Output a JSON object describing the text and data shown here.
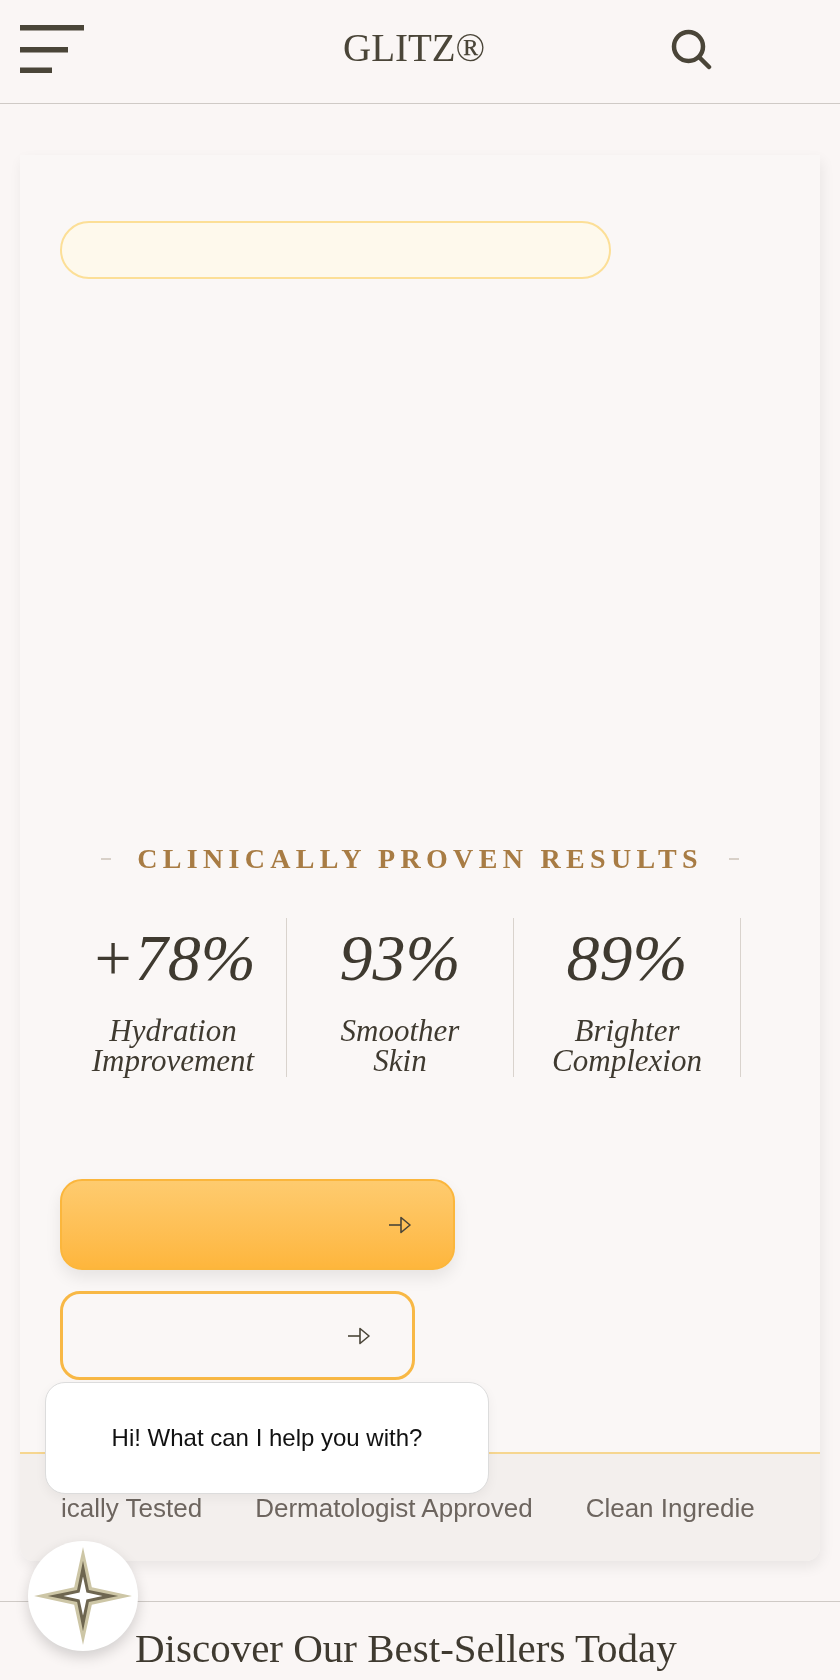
{
  "header": {
    "logo": "GLITZ®"
  },
  "results": {
    "title": "CLINICALLY PROVEN RESULTS",
    "stats": [
      {
        "value": "+78%",
        "label": "Hydration Improvement"
      },
      {
        "value": "93%",
        "label": "Smoother Skin"
      },
      {
        "value": "89%",
        "label": "Brighter Complexion"
      }
    ]
  },
  "buttons": [
    {
      "kind": "filled"
    },
    {
      "kind": "outline"
    }
  ],
  "trust_strip": [
    "ically Tested",
    "Dermatologist Approved",
    "Clean Ingredie"
  ],
  "chat": {
    "greeting": "Hi! What can I help you with?"
  },
  "section": {
    "title": "Discover Our Best-Sellers Today"
  }
}
